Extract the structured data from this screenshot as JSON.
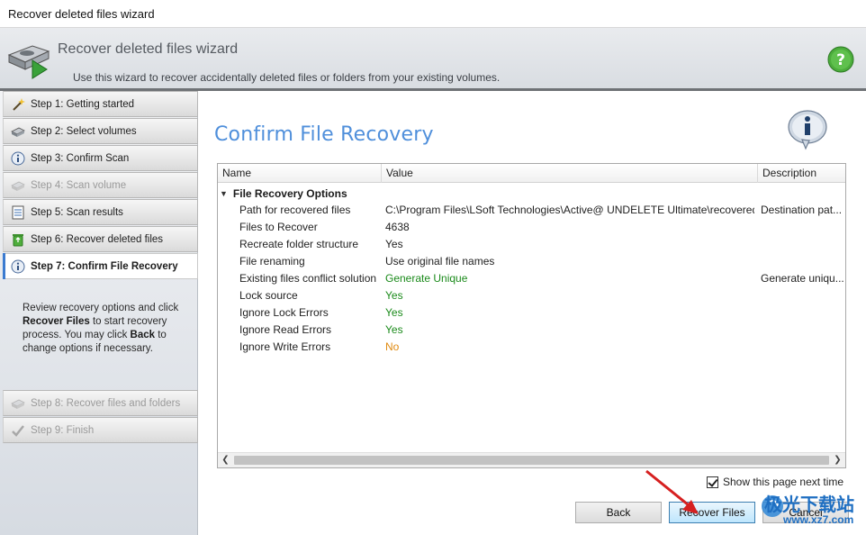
{
  "window": {
    "title": "Recover deleted files wizard"
  },
  "header": {
    "title": "Recover deleted files wizard",
    "subtitle": "Use this wizard to recover accidentally deleted files or folders from your existing volumes.",
    "icon": "hard-drive-recover-icon",
    "help_icon": "help-icon"
  },
  "sidebar": {
    "steps": [
      {
        "label": "Step 1: Getting started",
        "icon": "wand-icon",
        "state": "normal"
      },
      {
        "label": "Step 2: Select volumes",
        "icon": "drive-icon",
        "state": "normal"
      },
      {
        "label": "Step 3: Confirm Scan",
        "icon": "info-icon",
        "state": "normal"
      },
      {
        "label": "Step 4: Scan volume",
        "icon": "drive-icon",
        "state": "disabled"
      },
      {
        "label": "Step 5: Scan results",
        "icon": "list-icon",
        "state": "normal"
      },
      {
        "label": "Step 6: Recover deleted files",
        "icon": "recycle-icon",
        "state": "normal"
      },
      {
        "label": "Step 7: Confirm File Recovery",
        "icon": "info-icon",
        "state": "active"
      },
      {
        "label": "Step 8: Recover files and folders",
        "icon": "drive-icon",
        "state": "disabled"
      },
      {
        "label": "Step 9: Finish",
        "icon": "check-icon",
        "state": "disabled"
      }
    ],
    "description": {
      "p1": "Review recovery options and click ",
      "b1": "Recover Files",
      "p2": " to start recovery process. You may click ",
      "b2": "Back",
      "p3": " to change options if necessary."
    }
  },
  "main": {
    "title": "Confirm File Recovery",
    "info_icon": "info-bubble-icon",
    "grid": {
      "columns": [
        "Name",
        "Value",
        "Description"
      ],
      "group": "File Recovery Options",
      "rows": [
        {
          "name": "Path for recovered files",
          "value": "C:\\Program Files\\LSoft Technologies\\Active@ UNDELETE Ultimate\\recovered\\",
          "description": "Destination pat...",
          "color": ""
        },
        {
          "name": "Files to Recover",
          "value": "4638",
          "description": "",
          "color": ""
        },
        {
          "name": "Recreate folder structure",
          "value": "Yes",
          "description": "",
          "color": ""
        },
        {
          "name": "File renaming",
          "value": "Use original file names",
          "description": "",
          "color": ""
        },
        {
          "name": "Existing files conflict solution",
          "value": "Generate Unique",
          "description": "Generate uniqu...",
          "color": "green"
        },
        {
          "name": "Lock source",
          "value": "Yes",
          "description": "",
          "color": "green"
        },
        {
          "name": "Ignore Lock Errors",
          "value": "Yes",
          "description": "",
          "color": "green"
        },
        {
          "name": "Ignore Read Errors",
          "value": "Yes",
          "description": "",
          "color": "green"
        },
        {
          "name": "Ignore Write Errors",
          "value": "No",
          "description": "",
          "color": "orange"
        }
      ]
    },
    "show_next_time": {
      "label": "Show this page next time",
      "checked": true
    },
    "buttons": {
      "back": "Back",
      "recover": "Recover Files",
      "cancel": "Cancel"
    }
  },
  "watermark": {
    "line1": "极光下载站",
    "line2": "www.xz7.com"
  },
  "colors": {
    "accent": "#4f8fdb",
    "green": "#1a8a1a",
    "orange": "#e08a10",
    "arrow": "#d62020"
  }
}
